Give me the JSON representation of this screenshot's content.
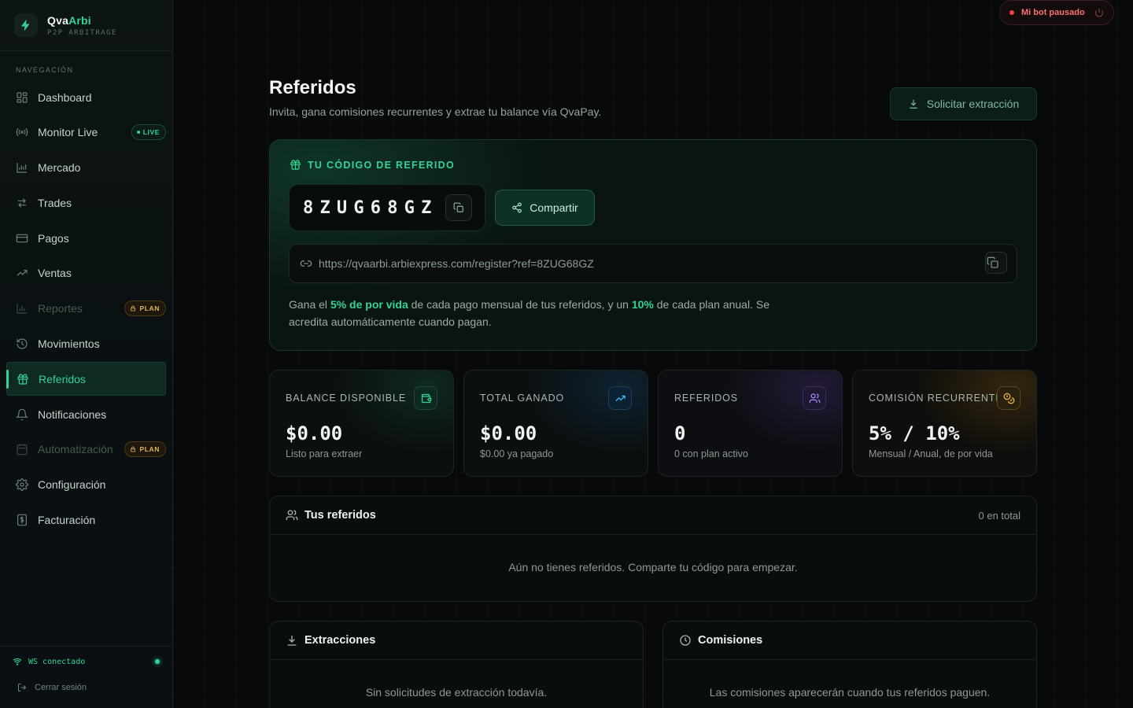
{
  "brand": {
    "name_part1": "Qva",
    "name_part2": "Arbi",
    "tagline": "P2P ARBITRAGE"
  },
  "nav": {
    "section_label": "NAVEGACIÓN",
    "items": [
      {
        "label": "Dashboard",
        "icon": "grid-icon"
      },
      {
        "label": "Monitor Live",
        "icon": "radio-icon",
        "badge": "LIVE"
      },
      {
        "label": "Mercado",
        "icon": "chart-icon"
      },
      {
        "label": "Trades",
        "icon": "arrows-icon"
      },
      {
        "label": "Pagos",
        "icon": "card-icon"
      },
      {
        "label": "Ventas",
        "icon": "trend-icon"
      },
      {
        "label": "Reportes",
        "icon": "bar-chart-icon",
        "badge": "PLAN",
        "disabled": true
      },
      {
        "label": "Movimientos",
        "icon": "history-icon"
      },
      {
        "label": "Referidos",
        "icon": "gift-icon",
        "active": true
      },
      {
        "label": "Notificaciones",
        "icon": "bell-icon"
      },
      {
        "label": "Automatización",
        "icon": "calendar-icon",
        "badge": "PLAN",
        "disabled": true
      },
      {
        "label": "Configuración",
        "icon": "gear-icon"
      },
      {
        "label": "Facturación",
        "icon": "receipt-icon"
      }
    ]
  },
  "footer": {
    "ws_status": "WS conectado",
    "logout": "Cerrar sesión"
  },
  "status": {
    "bot": "Mi bot pausado"
  },
  "page": {
    "title": "Referidos",
    "subtitle": "Invita, gana comisiones recurrentes y extrae tu balance vía QvaPay.",
    "extract_button": "Solicitar extracción"
  },
  "referral": {
    "label": "TU CÓDIGO DE REFERIDO",
    "code": "8ZUG68GZ",
    "share_button": "Compartir",
    "link": "https://qvaarbi.arbiexpress.com/register?ref=8ZUG68GZ",
    "desc_prefix": "Gana el ",
    "desc_bold1": "5% de por vida",
    "desc_mid": " de cada pago mensual de tus referidos, y un ",
    "desc_bold2": "10%",
    "desc_suffix": " de cada plan anual. Se acredita automáticamente cuando pagan."
  },
  "stats": [
    {
      "label": "BALANCE DISPONIBLE",
      "value": "$0.00",
      "sub": "Listo para extraer",
      "icon": "wallet-icon",
      "color": "#34d399"
    },
    {
      "label": "TOTAL GANADO",
      "value": "$0.00",
      "sub": "$0.00 ya pagado",
      "icon": "trend-up-icon",
      "color": "#38bdf8"
    },
    {
      "label": "REFERIDOS",
      "value": "0",
      "sub": "0 con plan activo",
      "icon": "users-icon",
      "color": "#a78bfa"
    },
    {
      "label": "COMISIÓN RECURRENTE",
      "value": "5% / 10%",
      "sub": "Mensual / Anual, de por vida",
      "icon": "coins-icon",
      "color": "#f5b83d"
    }
  ],
  "referrals_panel": {
    "title": "Tus referidos",
    "count": "0 en total",
    "empty": "Aún no tienes referidos. Comparte tu código para empezar."
  },
  "extractions_panel": {
    "title": "Extracciones",
    "empty": "Sin solicitudes de extracción todavía."
  },
  "commissions_panel": {
    "title": "Comisiones",
    "empty": "Las comisiones aparecerán cuando tus referidos paguen."
  }
}
